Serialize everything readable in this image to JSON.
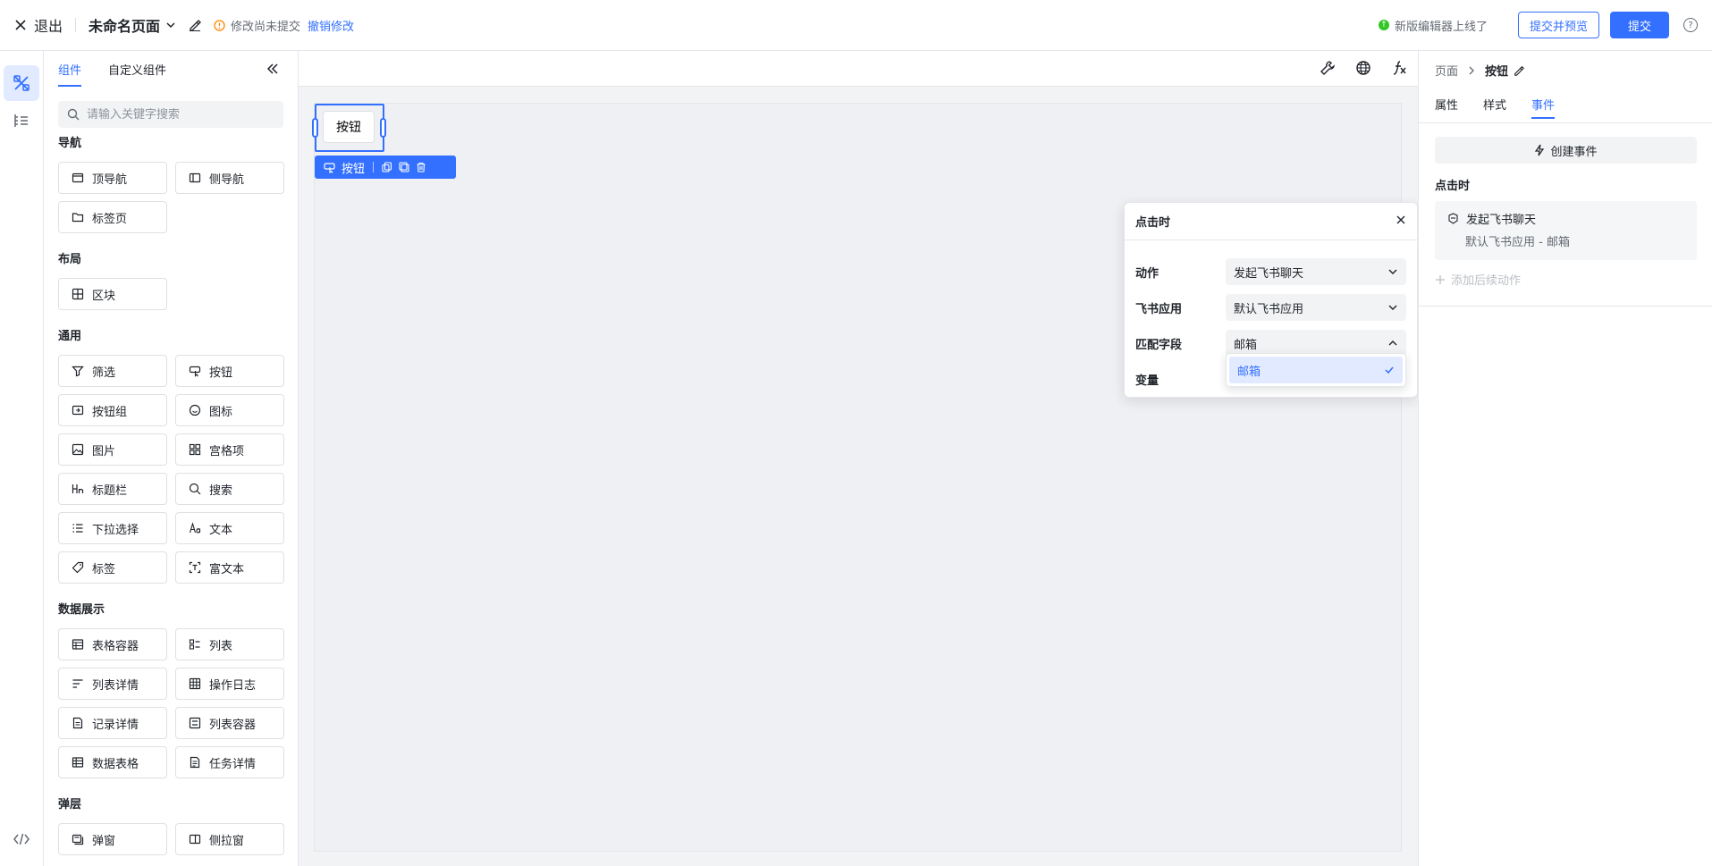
{
  "header": {
    "exit_label": "退出",
    "page_title": "未命名页面",
    "unsaved_text": "修改尚未提交",
    "undo_label": "撤销修改",
    "new_editor_text": "新版编辑器上线了",
    "submit_preview_label": "提交并预览",
    "submit_label": "提交",
    "help_icon_text": "?",
    "icons": [
      "close-icon",
      "chevron-down-icon",
      "edit-icon",
      "warning-icon",
      "help-icon"
    ]
  },
  "colors": {
    "accent": "#3370ff",
    "text": "#1f2329",
    "muted": "#646a73",
    "border": "#dee0e3",
    "success": "#34c724",
    "warning": "#ff8800"
  },
  "left_panel": {
    "tabs": [
      {
        "label": "组件",
        "active": true
      },
      {
        "label": "自定义组件",
        "active": false
      }
    ],
    "search_placeholder": "请输入关键字搜索",
    "groups": [
      {
        "title": "导航",
        "items": [
          {
            "label": "顶导航",
            "icon": "top-nav-icon"
          },
          {
            "label": "侧导航",
            "icon": "side-nav-icon"
          },
          {
            "label": "标签页",
            "icon": "folder-icon"
          }
        ]
      },
      {
        "title": "布局",
        "items": [
          {
            "label": "区块",
            "icon": "grid-block-icon"
          }
        ]
      },
      {
        "title": "通用",
        "items": [
          {
            "label": "筛选",
            "icon": "filter-icon"
          },
          {
            "label": "按钮",
            "icon": "button-icon"
          },
          {
            "label": "按钮组",
            "icon": "button-group-icon"
          },
          {
            "label": "图标",
            "icon": "smile-icon"
          },
          {
            "label": "图片",
            "icon": "image-icon"
          },
          {
            "label": "宫格项",
            "icon": "grid-item-icon"
          },
          {
            "label": "标题栏",
            "icon": "heading-icon"
          },
          {
            "label": "搜索",
            "icon": "search-icon"
          },
          {
            "label": "下拉选择",
            "icon": "list-icon"
          },
          {
            "label": "文本",
            "icon": "text-icon"
          },
          {
            "label": "标签",
            "icon": "tag-icon"
          },
          {
            "label": "富文本",
            "icon": "rich-text-icon"
          }
        ]
      },
      {
        "title": "数据展示",
        "items": [
          {
            "label": "表格容器",
            "icon": "table-icon"
          },
          {
            "label": "列表",
            "icon": "list-view-icon"
          },
          {
            "label": "列表详情",
            "icon": "list-detail-icon"
          },
          {
            "label": "操作日志",
            "icon": "log-icon"
          },
          {
            "label": "记录详情",
            "icon": "record-icon"
          },
          {
            "label": "列表容器",
            "icon": "list-container-icon"
          },
          {
            "label": "数据表格",
            "icon": "data-table-icon"
          },
          {
            "label": "任务详情",
            "icon": "task-icon"
          }
        ]
      },
      {
        "title": "弹层",
        "items": [
          {
            "label": "弹窗",
            "icon": "modal-icon"
          },
          {
            "label": "侧拉窗",
            "icon": "drawer-icon"
          }
        ]
      }
    ]
  },
  "canvas": {
    "button_label": "按钮",
    "selection_toolbar_label": "按钮"
  },
  "popup": {
    "title": "点击时",
    "rows": [
      {
        "label": "动作",
        "value": "发起飞书聊天"
      },
      {
        "label": "飞书应用",
        "value": "默认飞书应用"
      },
      {
        "label": "匹配字段",
        "value": "邮箱"
      },
      {
        "label": "变量",
        "value": ""
      }
    ],
    "dropdown_option": "邮箱"
  },
  "right_panel": {
    "breadcrumb": [
      "页面",
      "按钮"
    ],
    "tabs": [
      {
        "label": "属性",
        "active": false
      },
      {
        "label": "样式",
        "active": false
      },
      {
        "label": "事件",
        "active": true
      }
    ],
    "create_event_label": "创建事件",
    "event_trigger_label": "点击时",
    "action_title": "发起飞书聊天",
    "action_subtitle": "默认飞书应用 - 邮箱",
    "add_followup_label": "添加后续动作"
  }
}
